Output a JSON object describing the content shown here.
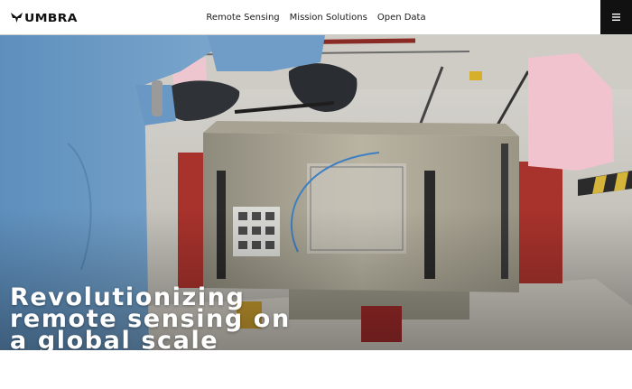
{
  "brand": {
    "name": "UMBRA",
    "logo_icon": "umbra-bird-icon"
  },
  "nav": {
    "items": [
      {
        "label": "Remote Sensing"
      },
      {
        "label": "Mission Solutions"
      },
      {
        "label": "Open Data"
      }
    ],
    "menu_icon": "hamburger-menu-icon"
  },
  "hero": {
    "title_lines": [
      "Revolutionizing",
      "remote sensing on",
      "a global scale"
    ]
  },
  "colors": {
    "header_bg": "#ffffff",
    "menu_bg": "#111111",
    "hero_text": "#ffffff"
  }
}
